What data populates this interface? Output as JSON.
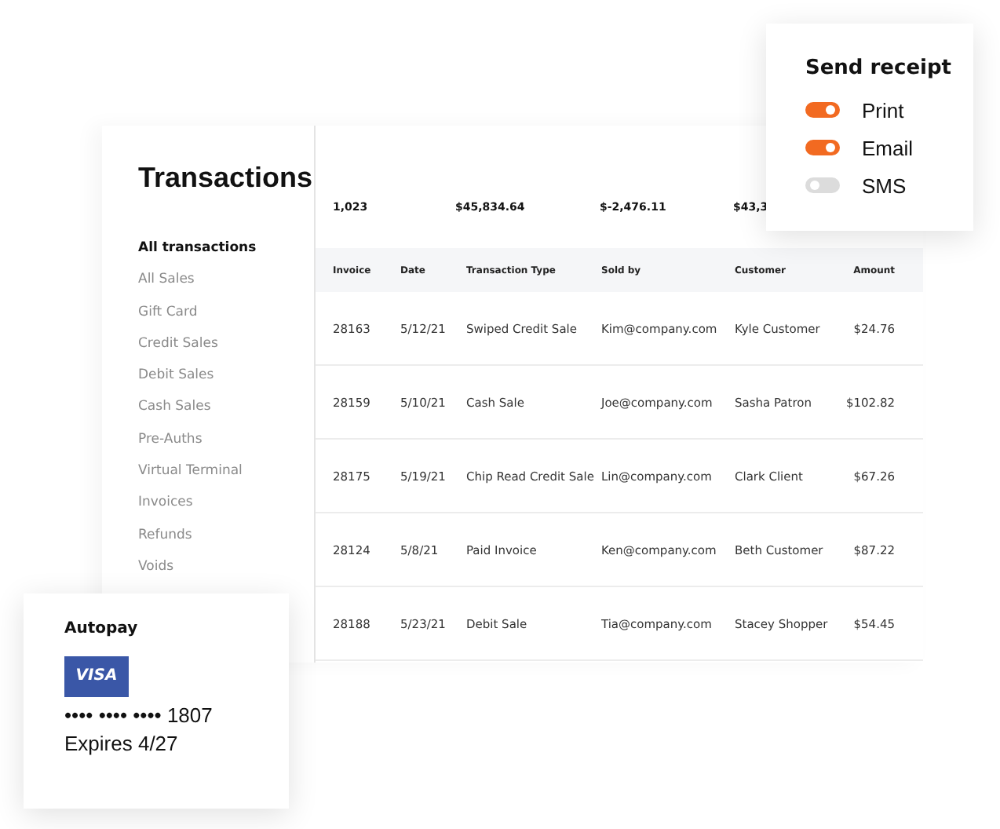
{
  "sidebar": {
    "title": "Transactions",
    "items": [
      {
        "label": "All transactions",
        "selected": true
      },
      {
        "label": "All Sales",
        "selected": false
      },
      {
        "label": "Gift Card",
        "selected": false
      },
      {
        "label": "Credit Sales",
        "selected": false
      },
      {
        "label": "Debit Sales",
        "selected": false
      },
      {
        "label": "Cash Sales",
        "selected": false
      },
      {
        "label": "Pre-Auths",
        "selected": false
      },
      {
        "label": "Virtual Terminal",
        "selected": false
      },
      {
        "label": "Invoices",
        "selected": false
      },
      {
        "label": "Refunds",
        "selected": false
      },
      {
        "label": "Voids",
        "selected": false
      }
    ]
  },
  "summary": [
    "1,023",
    "$45,834.64",
    "$-2,476.11",
    "$43,3"
  ],
  "table": {
    "columns": [
      "Invoice",
      "Date",
      "Transaction Type",
      "Sold by",
      "Customer",
      "Amount"
    ],
    "rows": [
      [
        "28163",
        "5/12/21",
        "Swiped Credit Sale",
        "Kim@company.com",
        "Kyle Customer",
        "$24.76"
      ],
      [
        "28159",
        "5/10/21",
        "Cash Sale",
        "Joe@company.com",
        "Sasha Patron",
        "$102.82"
      ],
      [
        "28175",
        "5/19/21",
        "Chip Read Credit Sale",
        "Lin@company.com",
        "Clark Client",
        "$67.26"
      ],
      [
        "28124",
        "5/8/21",
        "Paid Invoice",
        "Ken@company.com",
        "Beth Customer",
        "$87.22"
      ],
      [
        "28188",
        "5/23/21",
        "Debit Sale",
        "Tia@company.com",
        "Stacey Shopper",
        "$54.45"
      ]
    ]
  },
  "send_receipt": {
    "title": "Send receipt",
    "options": [
      {
        "label": "Print",
        "on": true
      },
      {
        "label": "Email",
        "on": true
      },
      {
        "label": "SMS",
        "on": false
      }
    ]
  },
  "autopay": {
    "title": "Autopay",
    "card_brand": "VISA",
    "card_number": "•••• •••• •••• 1807",
    "expires": "Expires 4/27"
  }
}
